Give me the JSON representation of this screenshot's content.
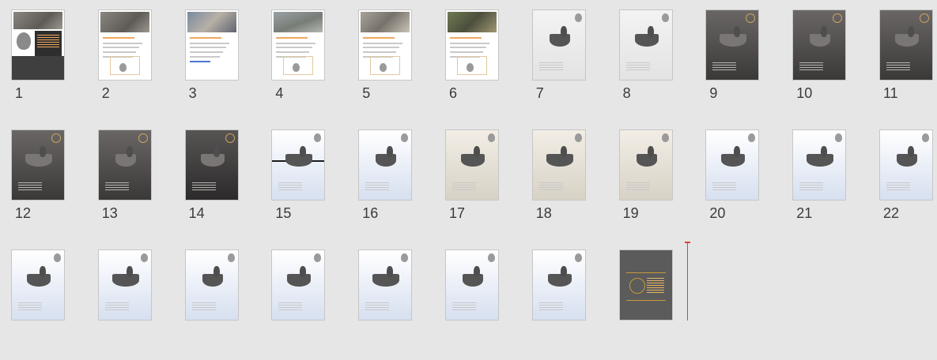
{
  "app": "Slide Sorter",
  "slides": [
    {
      "number": "1",
      "style": "cover"
    },
    {
      "number": "2",
      "style": "doc-grey"
    },
    {
      "number": "3",
      "style": "doc-blue"
    },
    {
      "number": "4",
      "style": "doc-river"
    },
    {
      "number": "5",
      "style": "doc-rocks"
    },
    {
      "number": "6",
      "style": "doc-green"
    },
    {
      "number": "7",
      "style": "light"
    },
    {
      "number": "8",
      "style": "light"
    },
    {
      "number": "9",
      "style": "dark"
    },
    {
      "number": "10",
      "style": "dark"
    },
    {
      "number": "11",
      "style": "dark"
    },
    {
      "number": "12",
      "style": "dark"
    },
    {
      "number": "13",
      "style": "dark"
    },
    {
      "number": "14",
      "style": "darker"
    },
    {
      "number": "15",
      "style": "blue-split"
    },
    {
      "number": "16",
      "style": "blue"
    },
    {
      "number": "17",
      "style": "beige"
    },
    {
      "number": "18",
      "style": "beige"
    },
    {
      "number": "19",
      "style": "beige"
    },
    {
      "number": "20",
      "style": "blue"
    },
    {
      "number": "21",
      "style": "blue"
    },
    {
      "number": "22",
      "style": "blue"
    },
    {
      "number": "",
      "style": "blue"
    },
    {
      "number": "",
      "style": "blue"
    },
    {
      "number": "",
      "style": "blue"
    },
    {
      "number": "",
      "style": "blue"
    },
    {
      "number": "",
      "style": "blue"
    },
    {
      "number": "",
      "style": "blue"
    },
    {
      "number": "",
      "style": "blue"
    },
    {
      "number": "",
      "style": "closing"
    }
  ],
  "colors": {
    "background": "#e6e6e6",
    "insertion_cursor": "#e0402a",
    "accent_orange": "#f0a860",
    "thumb_border": "#c6c6c6"
  },
  "icons": {
    "insertion_marker": "insertion-cursor-icon"
  }
}
